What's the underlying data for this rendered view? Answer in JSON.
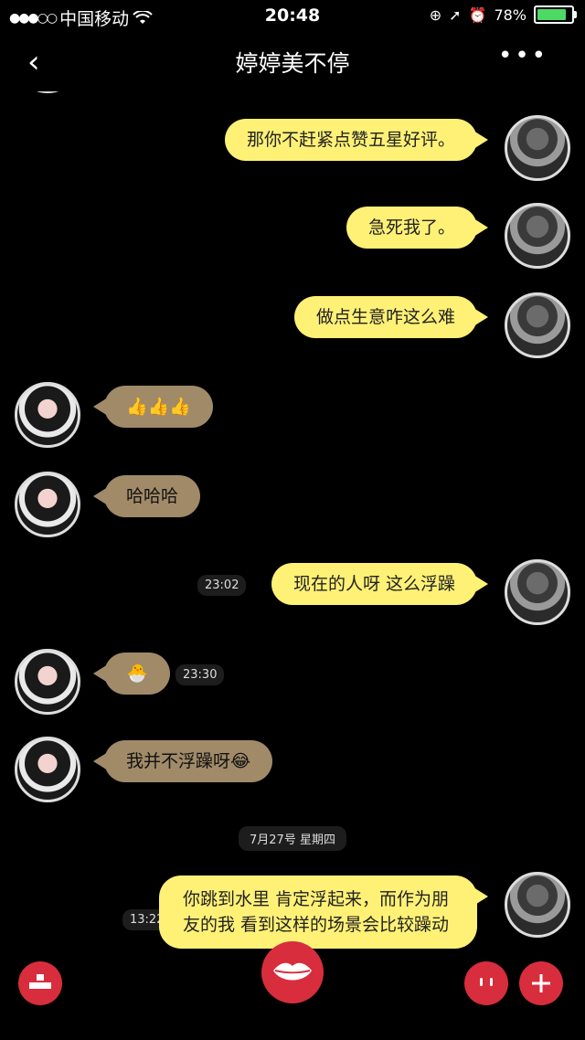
{
  "status_bar": {
    "carrier": "中国移动",
    "time": "20:48",
    "battery": "78%"
  },
  "nav": {
    "title": "婷婷美不停",
    "more_label": "•••"
  },
  "messages": [
    {
      "type": "out",
      "text": "那你不赶紧点赞五星好评。"
    },
    {
      "type": "out",
      "text": "急死我了。"
    },
    {
      "type": "out",
      "text": "做点生意咋这么难"
    },
    {
      "type": "in",
      "text": "👍👍👍"
    },
    {
      "type": "in",
      "text": "哈哈哈"
    },
    {
      "type": "out",
      "text": "现在的人呀 这么浮躁",
      "time": "23:02"
    },
    {
      "type": "in",
      "text": "🐣",
      "time": "23:30"
    },
    {
      "type": "in",
      "text": "我并不浮躁呀😂"
    },
    {
      "type": "out",
      "text": "你跳到水里 肯定浮起来，而作为朋友的我 看到这样的场景会比较躁动",
      "time": "13:22"
    }
  ],
  "date_separator": "7月27号 星期四",
  "colors": {
    "outgoing_bubble": "#fff176",
    "incoming_bubble": "#a08a68",
    "accent": "#d82d3c"
  }
}
